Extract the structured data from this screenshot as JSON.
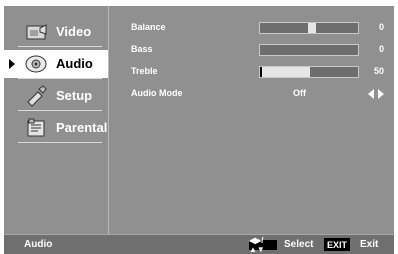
{
  "menu": {
    "items": [
      {
        "label": "Video",
        "icon": "video-icon"
      },
      {
        "label": "Audio",
        "icon": "audio-icon",
        "selected": true
      },
      {
        "label": "Setup",
        "icon": "setup-icon"
      },
      {
        "label": "Parental",
        "icon": "parental-icon"
      }
    ]
  },
  "settings": {
    "balance": {
      "label": "Balance",
      "value": "0",
      "level": 0.5
    },
    "bass": {
      "label": "Bass",
      "value": "0",
      "level": 0.0
    },
    "treble": {
      "label": "Treble",
      "value": "50",
      "level": 0.5
    },
    "audio_mode": {
      "label": "Audio Mode",
      "value": "Off"
    }
  },
  "footer": {
    "title": "Audio",
    "nav_hint": "◀▶/▲▼",
    "select_label": "Select",
    "exit_key": "EXIT",
    "exit_label": "Exit"
  },
  "colors": {
    "panel": "#909090",
    "footer": "#6f6f6f",
    "selected_bg": "#ffffff"
  }
}
